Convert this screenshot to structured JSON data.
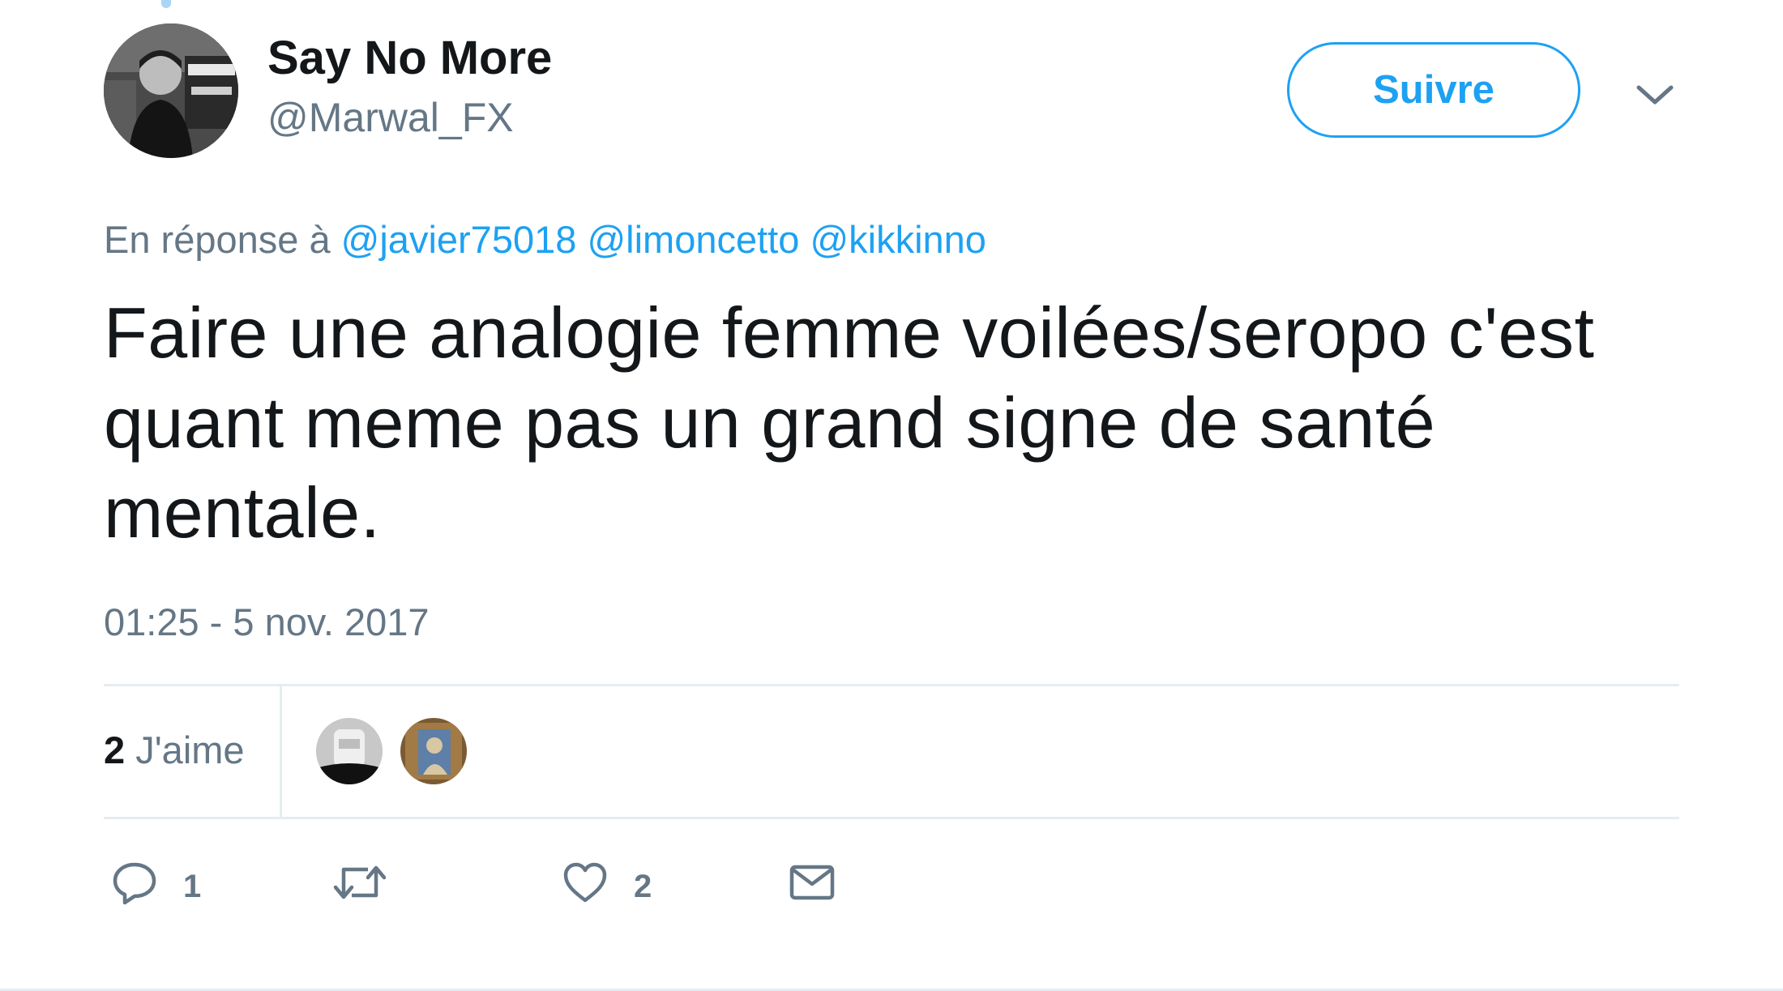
{
  "tweet": {
    "author": {
      "display_name": "Say No More",
      "handle": "@Marwal_FX",
      "avatar_icon": "user-avatar"
    },
    "follow_label": "Suivre",
    "menu_icon": "chevron-down-icon",
    "reply_context": {
      "prefix": "En réponse à",
      "mentions": [
        "@javier75018",
        "@limoncetto",
        "@kikkinno"
      ]
    },
    "text": "Faire une analogie femme voilées/seropo c'est quant meme pas un grand signe de santé mentale.",
    "timestamp": "01:25 - 5 nov. 2017",
    "stats": {
      "likes_count": "2",
      "likes_label": "J'aime"
    },
    "actions": {
      "reply_count": "1",
      "retweet_count": "",
      "like_count": "2"
    }
  },
  "colors": {
    "accent": "#1da1f2",
    "text": "#14171a",
    "muted": "#657786",
    "border": "#e6ecf0"
  }
}
